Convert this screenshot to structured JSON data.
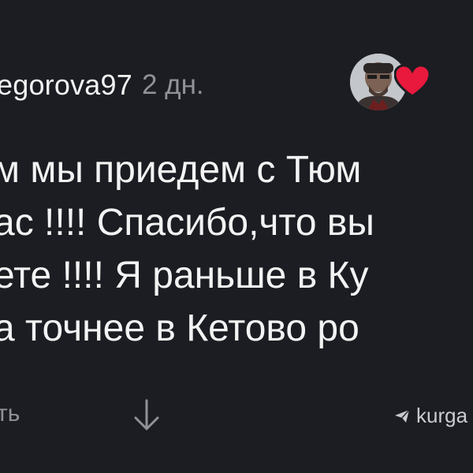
{
  "comment": {
    "username": "egorova97",
    "time": "2 дн.",
    "text_lines": [
      "м мы приедем с Тюм",
      "ас !!!! Спасибо,что вы",
      "ете !!!! Я раньше в Ку",
      "а точнее в Кетово ро"
    ],
    "reply_label": "ть",
    "source_label": "kurga",
    "icons": {
      "avatar": "avatar",
      "heart": "heart-icon",
      "down": "arrow-down-icon",
      "source": "send-icon"
    },
    "colors": {
      "background": "#1b1d22",
      "text": "#f3f3f3",
      "muted": "#8f9296",
      "heart": "#e8193c"
    }
  }
}
